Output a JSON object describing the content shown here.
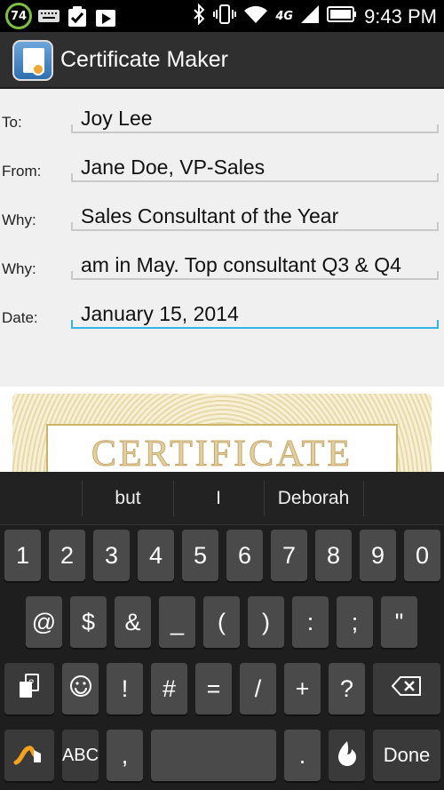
{
  "status_bar": {
    "battery_badge": "74",
    "network": "4G",
    "time": "9:43 PM"
  },
  "app": {
    "title": "Certificate Maker"
  },
  "form": {
    "to": {
      "label": "To:",
      "value": "Joy Lee"
    },
    "from": {
      "label": "From:",
      "value": "Jane Doe, VP-Sales"
    },
    "why1": {
      "label": "Why:",
      "value": "Sales Consultant of the Year"
    },
    "why2": {
      "label": "Why:",
      "value": "am in May. Top consultant Q3 & Q4"
    },
    "date": {
      "label": "Date:",
      "value": "January 15, 2014"
    }
  },
  "certificate": {
    "title": "CERTIFICATE"
  },
  "keyboard": {
    "suggestions": [
      "but",
      "I",
      "Deborah"
    ],
    "row1": [
      "1",
      "2",
      "3",
      "4",
      "5",
      "6",
      "7",
      "8",
      "9",
      "0"
    ],
    "row2": [
      "@",
      "$",
      "&",
      "_",
      "(",
      ")",
      ":",
      ";",
      "\""
    ],
    "row3": [
      "!",
      "#",
      "=",
      "/",
      "+",
      "?"
    ],
    "abc_label": "ABC",
    "comma": ",",
    "period": ".",
    "done_label": "Done"
  }
}
